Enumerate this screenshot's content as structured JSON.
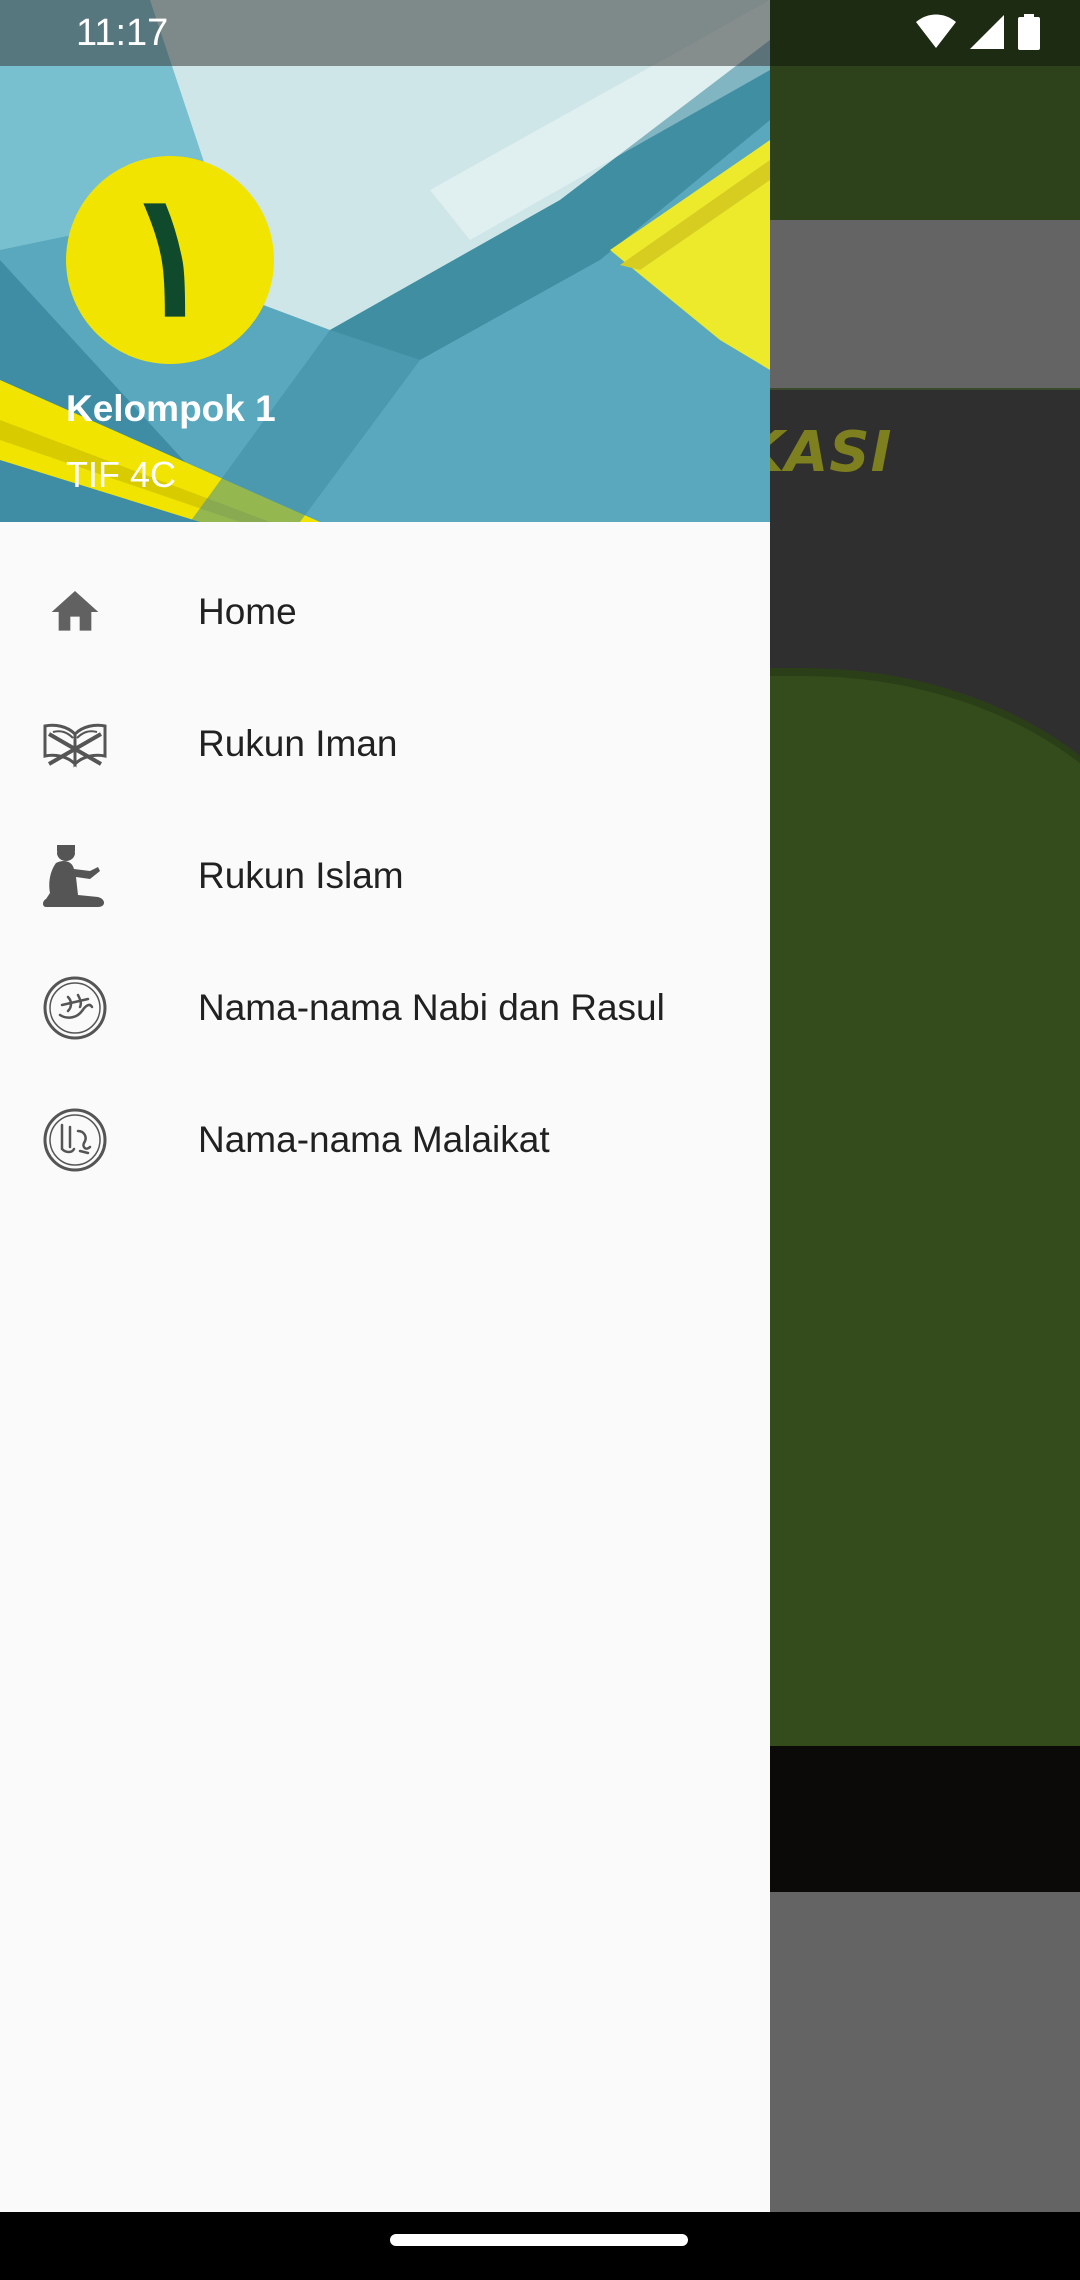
{
  "status_bar": {
    "time": "11:17",
    "icons": [
      "wifi-icon",
      "signal-icon",
      "battery-icon"
    ]
  },
  "drawer": {
    "header": {
      "avatar_numeral": "١",
      "name": "Kelompok 1",
      "subtitle": "TIF 4C"
    },
    "items": [
      {
        "label": "Home",
        "icon": "home-icon"
      },
      {
        "label": "Rukun Iman",
        "icon": "quran-book-icon"
      },
      {
        "label": "Rukun Islam",
        "icon": "praying-person-icon"
      },
      {
        "label": "Nama-nama Nabi dan Rasul",
        "icon": "muhammad-calligraphy-icon"
      },
      {
        "label": "Nama-nama Malaikat",
        "icon": "malaikat-calligraphy-icon"
      }
    ]
  },
  "background_app": {
    "title_fragment": "PLIKASI"
  },
  "colors": {
    "drawer_bg": "#fafafa",
    "header_teal": "#5ea9bd",
    "avatar_yellow": "#f0e400",
    "icon_gray": "#666666",
    "app_green": "#344c1c"
  }
}
